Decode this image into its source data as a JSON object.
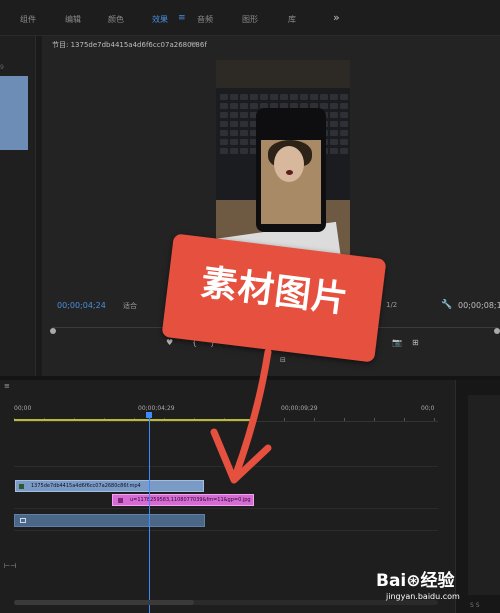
{
  "topbar": {
    "tabs": [
      "组件",
      "编辑",
      "颜色",
      "效果",
      "音频",
      "图形",
      "库"
    ],
    "active_tab": "效果",
    "more": "»",
    "menu_glyph": "≡"
  },
  "left_panel": {
    "number": "9"
  },
  "monitor": {
    "title": "节目: 1375de7db4415a4d6f6cc07a2680c86f",
    "menu_glyph": "≡",
    "timecode_current": "00;00;04;24",
    "fit_label": "适合",
    "scale_label": "1/2",
    "timecode_total": "00;00;08;1",
    "transport": [
      "♥",
      "{",
      "}",
      "⇤",
      "◂",
      "▶",
      "▸",
      "⇥",
      "⧉",
      "⊡",
      "📷",
      "⊞"
    ]
  },
  "annotation": {
    "text": "素材图片",
    "color": "#e6503f"
  },
  "timeline": {
    "menu_glyph": "≡",
    "ruler": [
      "00;00",
      "00;00;04;29",
      "00;00;09;29",
      "00;0"
    ],
    "playhead_color": "#3d8bff",
    "zoom_icon": "⊢⊣",
    "clips": {
      "video": {
        "label": "1375de7db4415a4d6f6cc07a2680c86f.mp4",
        "color": "#7b9bc7"
      },
      "image": {
        "label": "u=1178259583,1108077039&fm=11&gp=0.jpg",
        "color": "#d76bd6"
      }
    }
  },
  "right_panel": {
    "mark": "S S"
  },
  "watermark": {
    "logo": "Bai⊛经验",
    "url": "jingyan.baidu.com"
  }
}
